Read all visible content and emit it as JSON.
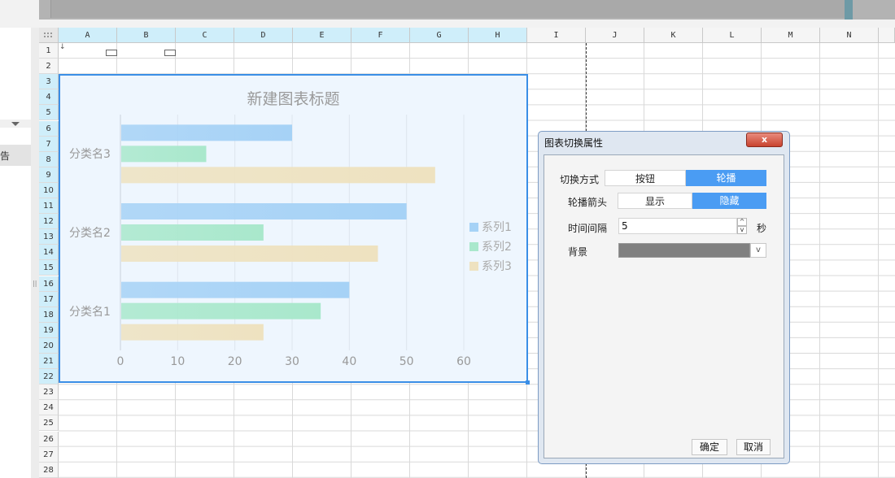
{
  "spreadsheet": {
    "columns": [
      "A",
      "B",
      "C",
      "D",
      "E",
      "F",
      "G",
      "H",
      "I",
      "J",
      "K",
      "L",
      "M",
      "N"
    ],
    "rows": [
      "1",
      "2",
      "3",
      "4",
      "5",
      "6",
      "7",
      "8",
      "9",
      "10",
      "11",
      "12",
      "13",
      "14",
      "15",
      "16",
      "17",
      "18",
      "19",
      "20",
      "21",
      "22",
      "23",
      "24",
      "25",
      "26",
      "27",
      "28"
    ],
    "a1_marker": "↓",
    "left_panel_char": "告",
    "splitter_grip": "||"
  },
  "chart_data": {
    "type": "bar",
    "orientation": "horizontal",
    "title": "新建图表标题",
    "categories": [
      "分类名1",
      "分类名2",
      "分类名3"
    ],
    "series": [
      {
        "name": "系列1",
        "values": [
          40,
          50,
          30
        ],
        "color": "#a6d2f6"
      },
      {
        "name": "系列2",
        "values": [
          35,
          25,
          15
        ],
        "color": "#a9e8cc"
      },
      {
        "name": "系列3",
        "values": [
          25,
          45,
          55
        ],
        "color": "#eee2c0"
      }
    ],
    "xlim": [
      0,
      60
    ],
    "xticks": [
      "0",
      "10",
      "20",
      "30",
      "40",
      "50",
      "60"
    ],
    "grid": true,
    "legend_position": "right"
  },
  "dialog": {
    "title": "图表切换属性",
    "close_label": "x",
    "switch_mode": {
      "label": "切换方式",
      "options": [
        "按钮",
        "轮播"
      ],
      "selected": "轮播"
    },
    "carousel_arrow": {
      "label": "轮播箭头",
      "options": [
        "显示",
        "隐藏"
      ],
      "selected": "隐藏"
    },
    "interval": {
      "label": "时间间隔",
      "value": "5",
      "unit": "秒",
      "up": "^",
      "down": "v"
    },
    "background": {
      "label": "背景",
      "color": "#808080",
      "dropdown": "v"
    },
    "ok_label": "确定",
    "cancel_label": "取消"
  }
}
